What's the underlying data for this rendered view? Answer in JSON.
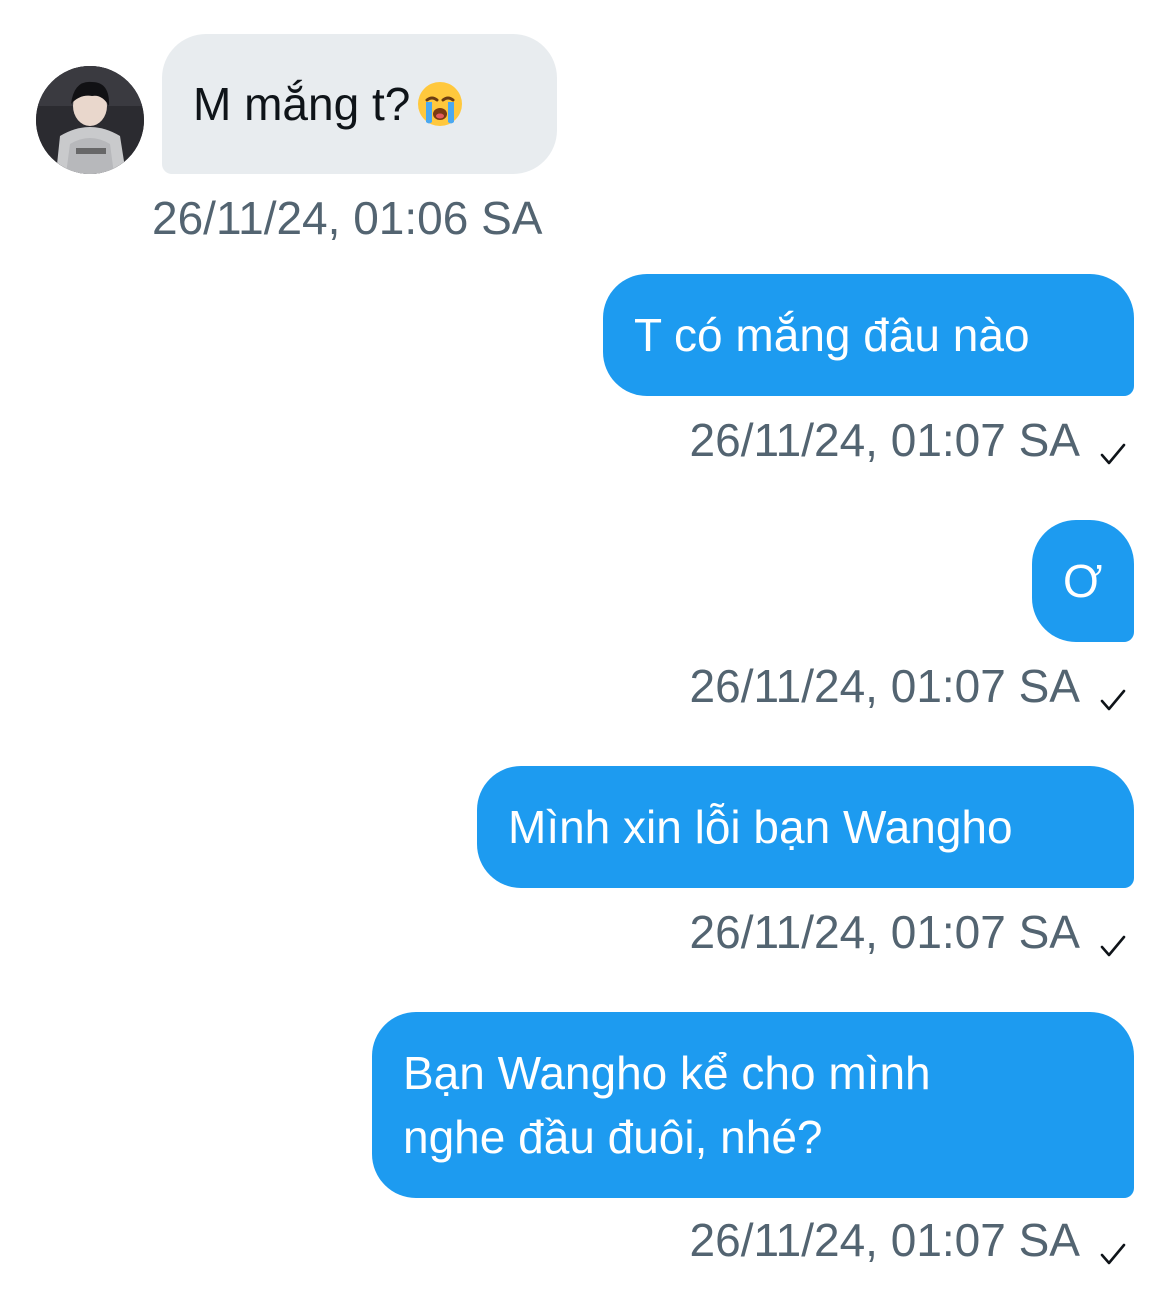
{
  "colors": {
    "incoming_bubble": "#e8ecef",
    "outgoing_bubble": "#1d9bf0",
    "timestamp": "#536471"
  },
  "conversation": {
    "incoming": {
      "text": "M mắng t?",
      "emoji": "loudly-crying-face",
      "timestamp": "26/11/24, 01:06 SA"
    },
    "outgoing": [
      {
        "lines": [
          "T có mắng đâu nào"
        ],
        "timestamp": "26/11/24, 01:07 SA",
        "status_icon": "check-icon"
      },
      {
        "lines": [
          "Ơ"
        ],
        "timestamp": "26/11/24, 01:07 SA",
        "status_icon": "check-icon"
      },
      {
        "lines": [
          "Mình xin lỗi bạn Wangho"
        ],
        "timestamp": "26/11/24, 01:07 SA",
        "status_icon": "check-icon"
      },
      {
        "lines": [
          "Bạn Wangho kể cho mình",
          "nghe đầu đuôi, nhé?"
        ],
        "timestamp": "26/11/24, 01:07 SA",
        "status_icon": "check-icon"
      }
    ]
  }
}
